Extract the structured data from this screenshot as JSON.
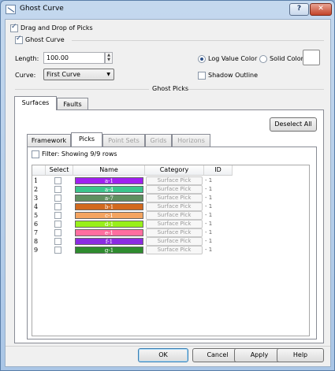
{
  "window": {
    "title": "Ghost Curve",
    "help_label": "?",
    "close_label": "✕"
  },
  "options": {
    "drag_drop_label": "Drag and Drop of Picks",
    "drag_drop_checked": true,
    "ghost_curve_label": "Ghost Curve",
    "ghost_curve_checked": true
  },
  "length": {
    "label": "Length:",
    "value": "100.00"
  },
  "curve": {
    "label": "Curve:",
    "value": "First Curve"
  },
  "color_mode": {
    "log_value_label": "Log Value Color",
    "solid_label": "Solid Color",
    "selected": "log_value",
    "solid_color": "#ffffff"
  },
  "shadow_outline": {
    "label": "Shadow Outline",
    "checked": false
  },
  "ghost_picks_label": "Ghost Picks",
  "top_tabs": [
    {
      "label": "Surfaces",
      "active": true
    },
    {
      "label": "Faults",
      "active": false
    }
  ],
  "deselect_all_label": "Deselect All",
  "sub_tabs": [
    {
      "label": "Framework",
      "active": false,
      "enabled": true
    },
    {
      "label": "Picks",
      "active": true,
      "enabled": true
    },
    {
      "label": "Point Sets",
      "active": false,
      "enabled": false
    },
    {
      "label": "Grids",
      "active": false,
      "enabled": false
    },
    {
      "label": "Horizons",
      "active": false,
      "enabled": false
    }
  ],
  "filter": {
    "label": "Filter: Showing 9/9 rows",
    "checked": false
  },
  "table": {
    "columns": [
      "Select",
      "Name",
      "Category",
      "ID"
    ],
    "rows": [
      {
        "num": "1",
        "name": "a-1",
        "color": "#a020f0",
        "category": "Surface Pick",
        "id": "- 1"
      },
      {
        "num": "2",
        "name": "a-4",
        "color": "#3cc48c",
        "category": "Surface Pick",
        "id": "- 1"
      },
      {
        "num": "3",
        "name": "a-7",
        "color": "#5f8f60",
        "category": "Surface Pick",
        "id": "- 1"
      },
      {
        "num": "4",
        "name": "b-1",
        "color": "#d2691e",
        "category": "Surface Pick",
        "id": "- 1"
      },
      {
        "num": "5",
        "name": "c-1",
        "color": "#f4a460",
        "category": "Surface Pick",
        "id": "- 1"
      },
      {
        "num": "6",
        "name": "d-1",
        "color": "#98f01a",
        "category": "Surface Pick",
        "id": "- 1"
      },
      {
        "num": "7",
        "name": "e-1",
        "color": "#ff6ea0",
        "category": "Surface Pick",
        "id": "- 1"
      },
      {
        "num": "8",
        "name": "f-1",
        "color": "#8a2be2",
        "category": "Surface Pick",
        "id": "- 1"
      },
      {
        "num": "9",
        "name": "g-1",
        "color": "#2e8b2e",
        "category": "Surface Pick",
        "id": "- 1"
      }
    ]
  },
  "buttons": {
    "ok": "OK",
    "cancel": "Cancel",
    "apply": "Apply",
    "help": "Help"
  }
}
